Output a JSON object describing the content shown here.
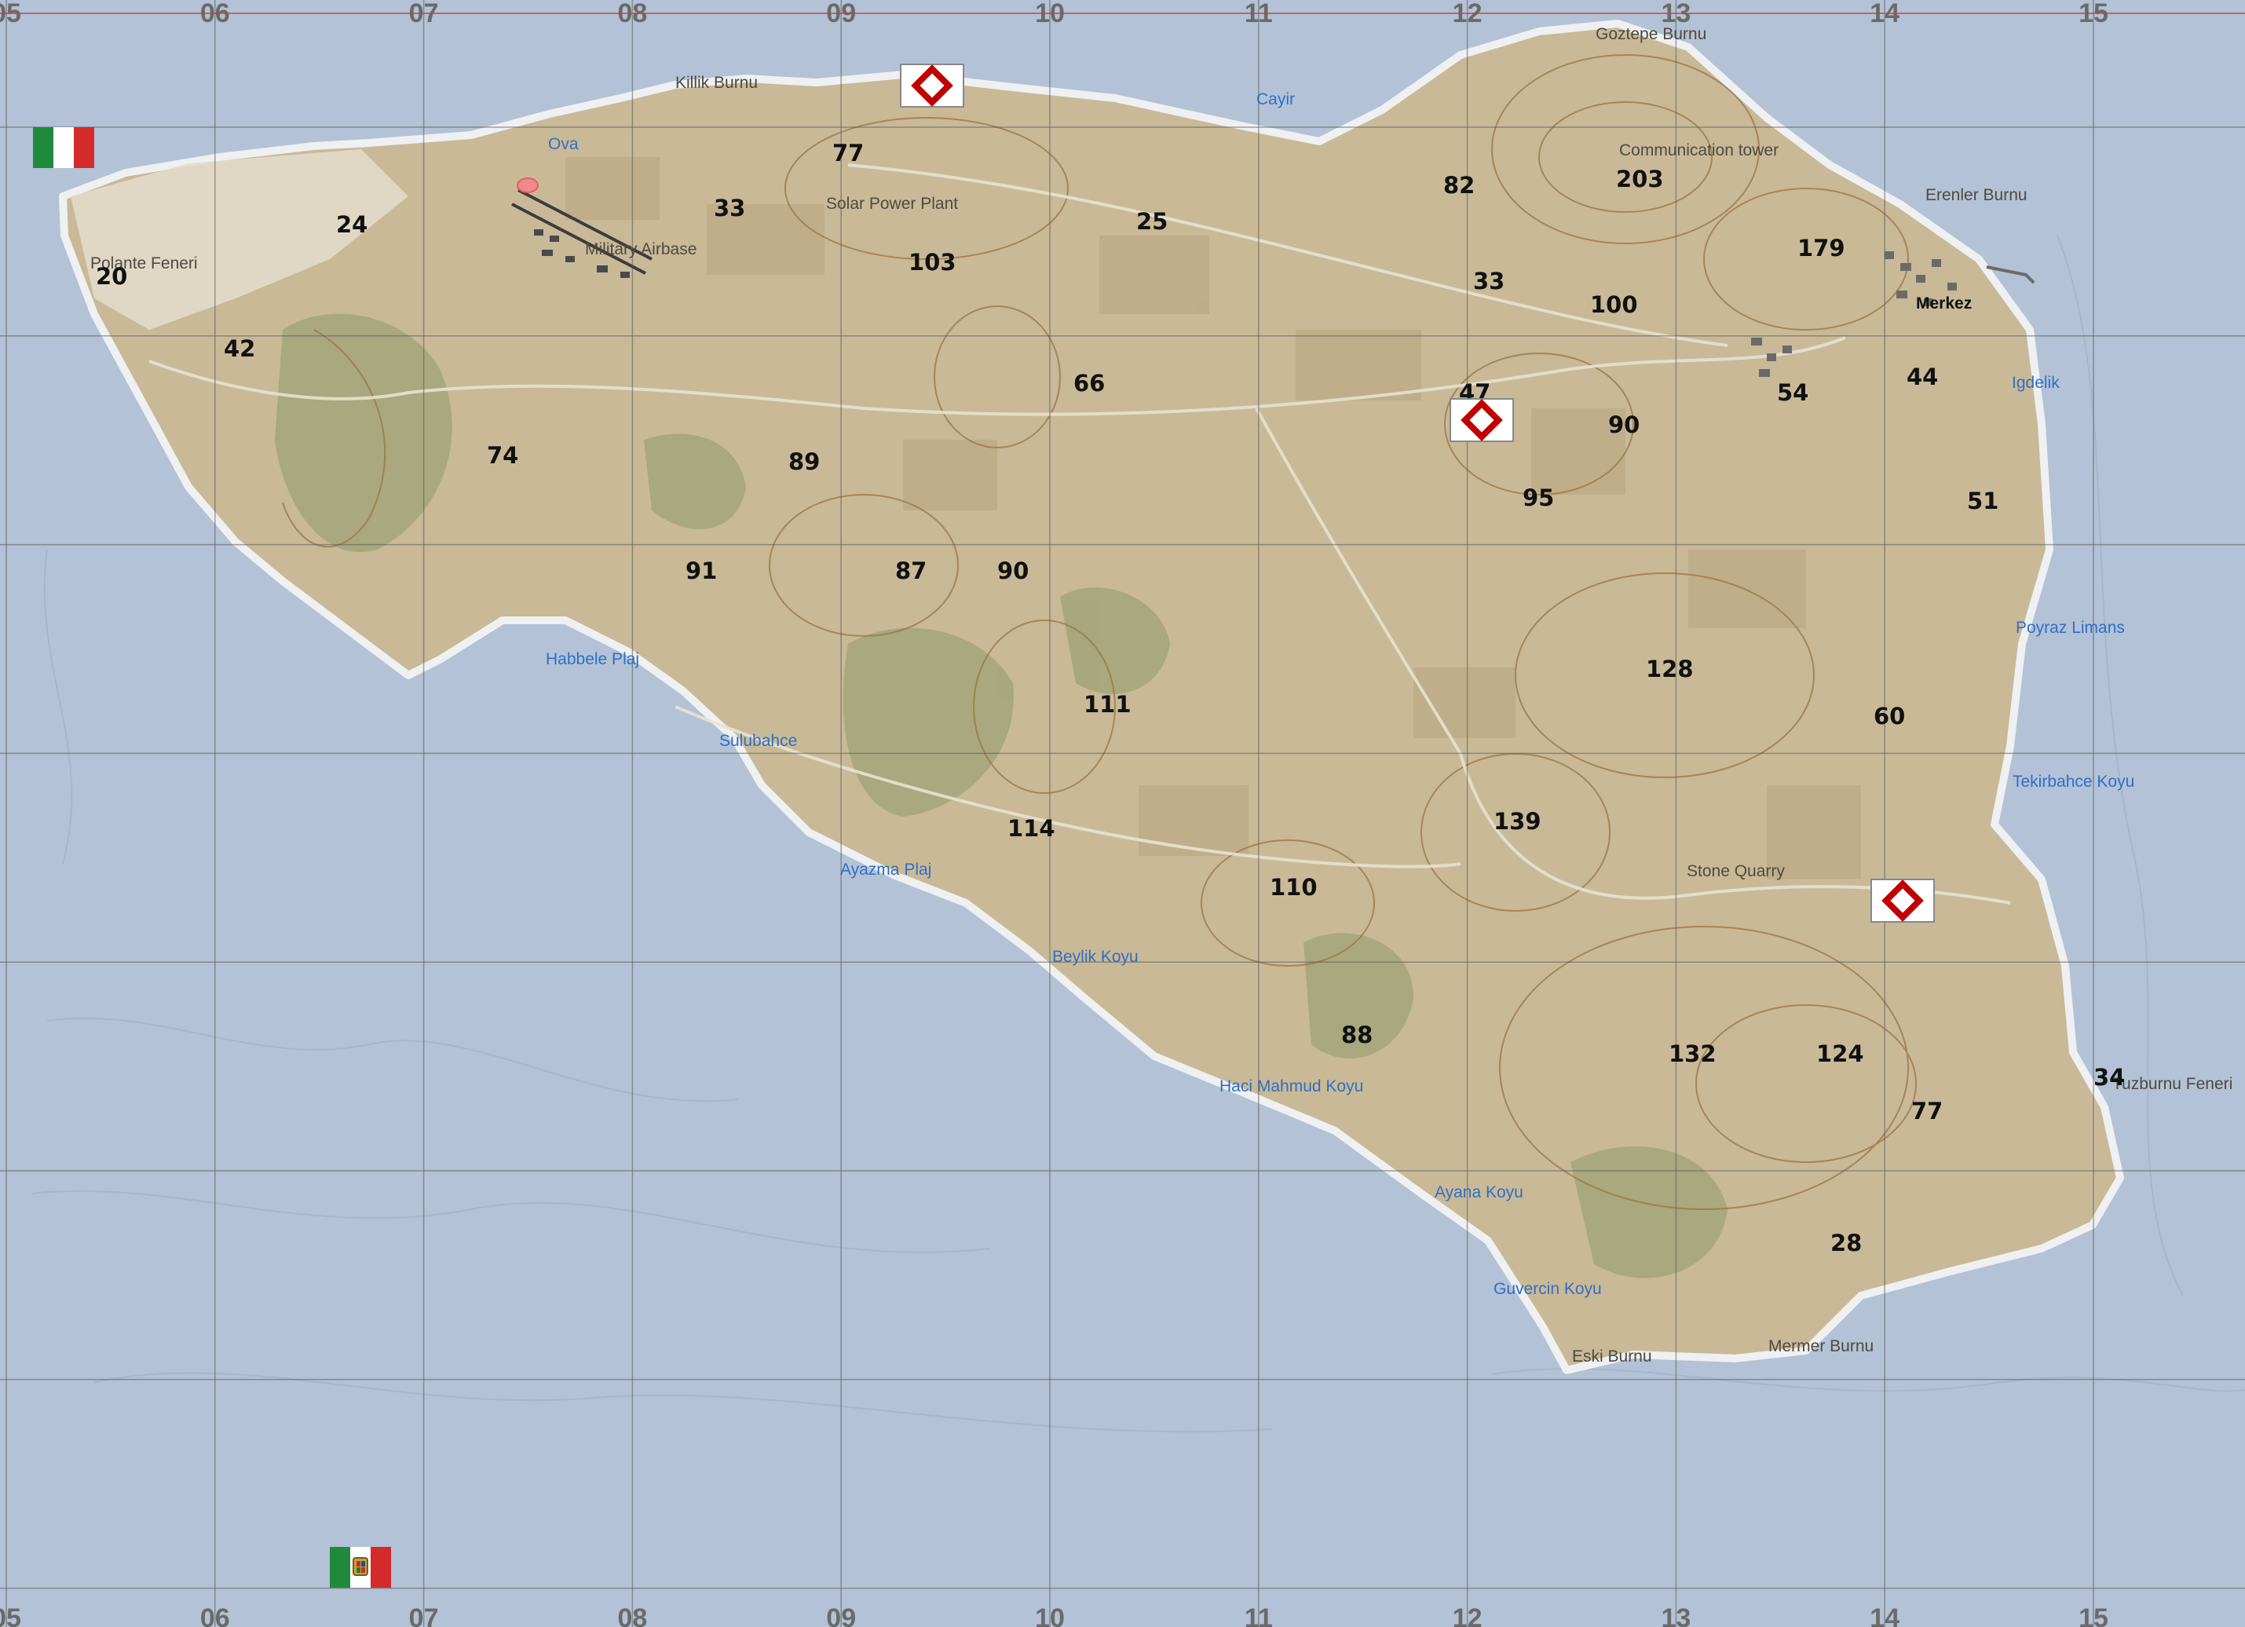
{
  "map": {
    "grid_columns": [
      "05",
      "06",
      "07",
      "08",
      "09",
      "10",
      "11",
      "12",
      "13",
      "14",
      "15"
    ],
    "elevations": [
      "24",
      "20",
      "42",
      "74",
      "33",
      "77",
      "103",
      "25",
      "89",
      "91",
      "87",
      "90",
      "66",
      "111",
      "114",
      "110",
      "82",
      "203",
      "33",
      "100",
      "179",
      "47",
      "90",
      "95",
      "54",
      "44",
      "51",
      "128",
      "60",
      "139",
      "88",
      "132",
      "124",
      "77",
      "34",
      "28"
    ],
    "places": {
      "killik_burnu": "Killik Burnu",
      "ova": "Ova",
      "polante_feneri": "Polante Feneri",
      "military_airbase": "Military Airbase",
      "solar_power_plant": "Solar Power Plant",
      "cayir": "Cayir",
      "goztepe_burnu": "Goztepe Burnu",
      "communication_tower": "Communication tower",
      "erenler_burnu": "Erenler Burnu",
      "merkez": "Merkez",
      "igdelik": "Igdelik",
      "habbele_plaj": "Habbele Plaj",
      "sulubahce": "Sulubahce",
      "ayazma_plaj": "Ayazma Plaj",
      "beylik_koyu": "Beylik Koyu",
      "haci_mahmud_koyu": "Haci Mahmud Koyu",
      "poyraz_limans": "Poyraz Limans",
      "tekirbahce_koyu": "Tekirbahce Koyu",
      "stone_quarry": "Stone Quarry",
      "tuzburnu_feneri": "Tuzburnu Feneri",
      "ayana_koyu": "Ayana Koyu",
      "guvercin_koyu": "Guvercin Koyu",
      "eski_burnu": "Eski Burnu",
      "mermer_burnu": "Mermer Burnu"
    },
    "objectives": [
      "objective-north",
      "objective-center",
      "objective-southeast"
    ],
    "icons": {
      "flag_top": "italian-flag-icon",
      "flag_bottom": "italian-naval-ensign-icon",
      "objective": "objective-diamond-icon"
    },
    "colors": {
      "sea": "#b3c2d6",
      "land": "#c9b997",
      "vegetation": "#8e9a6a",
      "grid": "#5a5a5a",
      "contour": "#9a7446",
      "objective_red": "#c00000"
    }
  }
}
